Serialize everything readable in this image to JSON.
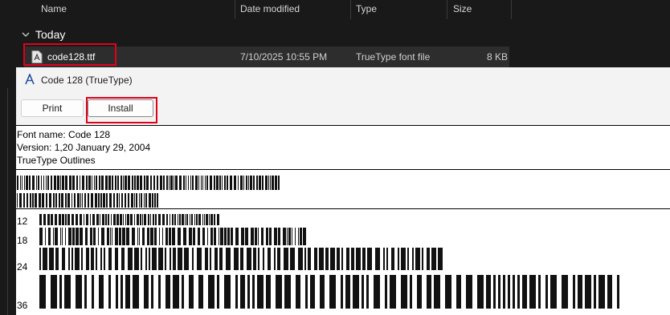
{
  "explorer": {
    "columns": {
      "name": "Name",
      "date": "Date modified",
      "type": "Type",
      "size": "Size"
    },
    "group": {
      "label": "Today"
    },
    "file": {
      "name": "code128.ttf",
      "date": "7/10/2025 10:55 PM",
      "type": "TrueType font file",
      "size": "8 KB",
      "icon": "font-file-icon"
    }
  },
  "viewer": {
    "title": "Code 128 (TrueType)",
    "title_icon": "font-icon",
    "buttons": {
      "print": "Print",
      "install": "Install"
    },
    "info": {
      "font_name": "Font name: Code 128",
      "version": "Version: 1,20 January 29, 2004",
      "outlines": "TrueType Outlines"
    },
    "sizes": [
      "12",
      "18",
      "24",
      "36"
    ]
  },
  "colors": {
    "explorer_bg": "#191919",
    "selected_row": "#2d2d2d",
    "highlight": "#e0001b",
    "viewer_bg": "#ffffff",
    "toolbar_bg": "#f3f3f3"
  }
}
